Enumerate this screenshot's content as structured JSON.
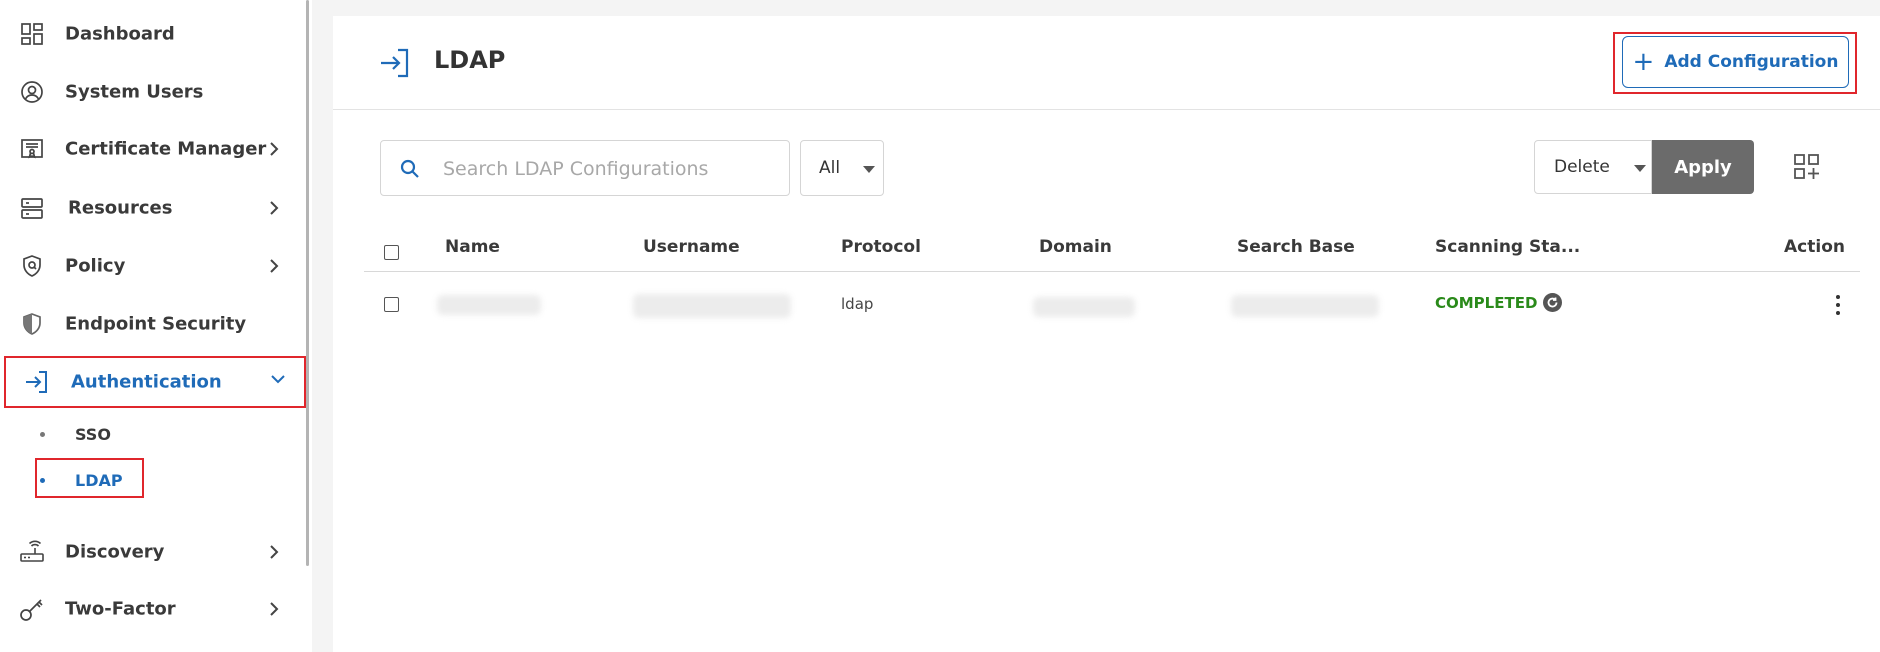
{
  "sidebar": {
    "items": [
      {
        "label": "Dashboard"
      },
      {
        "label": "System Users"
      },
      {
        "label": "Certificate Manager"
      },
      {
        "label": "Resources"
      },
      {
        "label": "Policy"
      },
      {
        "label": "Endpoint Security"
      },
      {
        "label": "Authentication"
      },
      {
        "label": "Discovery"
      },
      {
        "label": "Two-Factor"
      }
    ],
    "subitems": [
      {
        "label": "SSO"
      },
      {
        "label": "LDAP"
      }
    ]
  },
  "header": {
    "title": "LDAP",
    "add_button_label": "Add Configuration"
  },
  "toolbar": {
    "search_placeholder": "Search LDAP Configurations",
    "filter_value": "All",
    "bulk_action_value": "Delete",
    "apply_label": "Apply"
  },
  "table": {
    "columns": [
      "Name",
      "Username",
      "Protocol",
      "Domain",
      "Search Base",
      "Scanning Sta...",
      "Action"
    ],
    "rows": [
      {
        "protocol": "ldap",
        "status": "COMPLETED"
      }
    ]
  },
  "colors": {
    "accent": "#1f6bb8",
    "highlight": "#e0262c",
    "status_completed": "#2a8a1a",
    "apply_bg": "#6b6b6b"
  }
}
